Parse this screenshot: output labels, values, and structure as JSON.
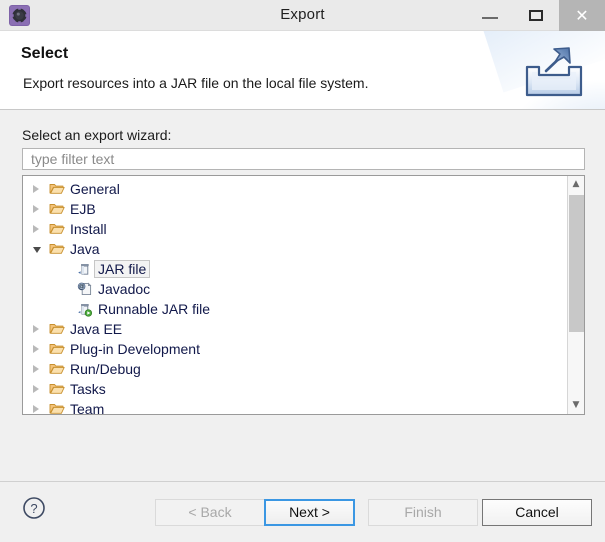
{
  "window": {
    "title": "Export",
    "app_icon": "eclipse-gear-icon",
    "controls": {
      "minimize": "minimize-icon",
      "maximize": "maximize-icon",
      "close": "close-icon"
    }
  },
  "header": {
    "title": "Select",
    "description": "Export resources into a JAR file on the local file system.",
    "banner_icon": "export-arrow-icon"
  },
  "main": {
    "field_label": "Select an export wizard:",
    "filter": {
      "value": "",
      "placeholder": "type filter text"
    },
    "tree": [
      {
        "label": "General",
        "level": 0,
        "state": "collapsed",
        "icon": "folder-icon",
        "selected": false
      },
      {
        "label": "EJB",
        "level": 0,
        "state": "collapsed",
        "icon": "folder-icon",
        "selected": false
      },
      {
        "label": "Install",
        "level": 0,
        "state": "collapsed",
        "icon": "folder-icon",
        "selected": false
      },
      {
        "label": "Java",
        "level": 0,
        "state": "expanded",
        "icon": "folder-icon",
        "selected": false
      },
      {
        "label": "JAR file",
        "level": 1,
        "state": "leaf",
        "icon": "jar-file-icon",
        "selected": true
      },
      {
        "label": "Javadoc",
        "level": 1,
        "state": "leaf",
        "icon": "javadoc-icon",
        "selected": false
      },
      {
        "label": "Runnable JAR file",
        "level": 1,
        "state": "leaf",
        "icon": "runnable-jar-icon",
        "selected": false
      },
      {
        "label": "Java EE",
        "level": 0,
        "state": "collapsed",
        "icon": "folder-icon",
        "selected": false
      },
      {
        "label": "Plug-in Development",
        "level": 0,
        "state": "collapsed",
        "icon": "folder-icon",
        "selected": false
      },
      {
        "label": "Run/Debug",
        "level": 0,
        "state": "collapsed",
        "icon": "folder-icon",
        "selected": false
      },
      {
        "label": "Tasks",
        "level": 0,
        "state": "collapsed",
        "icon": "folder-icon",
        "selected": false
      },
      {
        "label": "Team",
        "level": 0,
        "state": "collapsed",
        "icon": "folder-icon",
        "selected": false
      }
    ],
    "scrollbar": {
      "up_arrow": "chevron-up-icon",
      "down_arrow": "chevron-down-icon"
    }
  },
  "footer": {
    "help_icon": "help-question-icon",
    "buttons": {
      "back": {
        "label": "< Back",
        "enabled": false,
        "default": false
      },
      "next": {
        "label": "Next >",
        "enabled": true,
        "default": true
      },
      "finish": {
        "label": "Finish",
        "enabled": false,
        "default": false
      },
      "cancel": {
        "label": "Cancel",
        "enabled": true,
        "default": false
      }
    }
  },
  "colors": {
    "titlebar_bg": "#eaeaea",
    "dialog_bg": "#f0f0f0",
    "tree_text": "#11184a",
    "folder": "#e8a33d",
    "accent_focus": "#3b97e3",
    "close_hover": "#b5b5b5"
  }
}
